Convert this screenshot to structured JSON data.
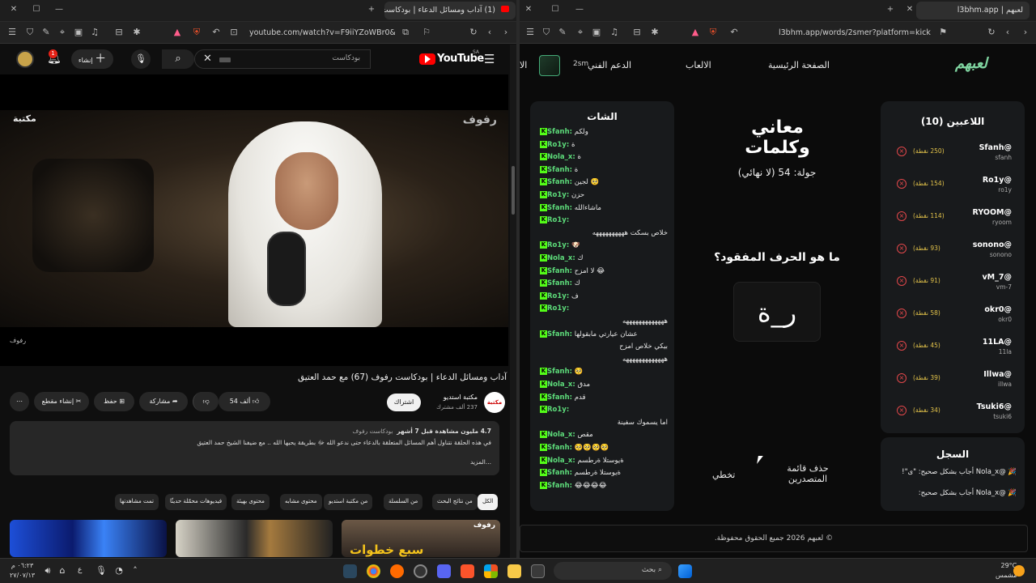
{
  "left_window": {
    "tab_title": "(1) آداب ومسائل الدعاء | بودكاست",
    "url": "youtube.com/watch?v=F9iiYZoWBr0&t=4s",
    "youtube": {
      "logo": "YouTube",
      "region": "SA",
      "search_value": "بودكاست",
      "create_label": "إنشاء",
      "notification_count": "1",
      "video_title": "آداب ومسائل الدعاء | بودكاست رفوف (67) مع حمد العتيق",
      "watermark": "رفوف",
      "channel_name": "مكتبة استديو",
      "channel_logo": "مكتبة",
      "subscribers": "237 ألف مشترك",
      "subscribe_label": "اشتراك",
      "likes": "54 ألف",
      "share_label": "مشاركة",
      "save_label": "حفظ",
      "clip_label": "إنشاء مقطع",
      "description_meta": "4.7 مليون مشاهدة قبل 7 أشهر",
      "description_tag": "بودكاست رفوف",
      "description_text": "في هذه الحلقة نتناول أهم المسائل المتعلقة بالدعاء حتى ندعو الله ﷻ بطريقة يحبها الله .. مع ضيفنا الشيخ حمد العتيق",
      "more_label": "...المزيد",
      "chips": [
        "الكل",
        "من نتائج البحث",
        "من السلسلة",
        "من مكتبة استديو",
        "محتوى مشابه",
        "محتوى بهيئة",
        "فيديوهات محمّلة حديثًا",
        "تمت مشاهدتها"
      ],
      "thumb_text": "سبع خطوات"
    }
  },
  "right_window": {
    "tab_title": "لعبهم | l3bhm.app",
    "url": "l3bhm.app/words/2smer?platform=kick",
    "site": {
      "logo": "لعبهم",
      "nav": [
        "الصفحة الرئيسية",
        "الالعاب",
        "الدعم الفني"
      ],
      "nav_cut": "الا",
      "user_handle": "2sm",
      "game_title": "معاني وكلمات",
      "round_label": "جولة: 54 (لا نهائي)",
      "question": "ما هو الحرف المفقود؟",
      "letters": "ر_ة",
      "skip_label": "تخطي",
      "delete_leaderboard_label": "حذف قائمة المتصدرين",
      "footer": "© لعبهم 2026 جميع الحقوق محفوظة."
    },
    "players_title": "اللاعبين (10)",
    "players": [
      {
        "name": "@Sfanh",
        "handle": "sfanh",
        "points": "(250 نقطة)"
      },
      {
        "name": "@Ro1y",
        "handle": "ro1y",
        "points": "(154 نقطة)"
      },
      {
        "name": "@RYOOM",
        "handle": "ryoom",
        "points": "(114 نقطة)"
      },
      {
        "name": "@sonono",
        "handle": "sonono",
        "points": "(93 نقطة)"
      },
      {
        "name": "@vM_7",
        "handle": "vm-7",
        "points": "(91 نقطة)"
      },
      {
        "name": "@okr0",
        "handle": "okr0",
        "points": "(58 نقطة)"
      },
      {
        "name": "@11LA",
        "handle": "11la",
        "points": "(45 نقطة)"
      },
      {
        "name": "@Illwa",
        "handle": "illwa",
        "points": "(39 نقطة)"
      },
      {
        "name": "@Tsuki6",
        "handle": "tsuki6",
        "points": "(34 نقطة)"
      }
    ],
    "log_title": "السجل",
    "log": [
      "🎉 @Nola_x أجاب بشكل صحيح: \"ى\"!",
      "🎉 @Nola_x أجاب بشكل صحيح:"
    ],
    "chat_title": "الشات",
    "chat": [
      {
        "user": "Sfanh",
        "msg": "ولكم"
      },
      {
        "user": "Ro1y",
        "msg": "ة"
      },
      {
        "user": "Nola_x",
        "msg": "ة"
      },
      {
        "user": "Sfanh",
        "msg": "ة"
      },
      {
        "user": "Sfanh",
        "msg": "لجين 🥺"
      },
      {
        "user": "Ro1y",
        "msg": "حزن"
      },
      {
        "user": "Sfanh",
        "msg": "ماشاءالله"
      },
      {
        "user": "Ro1y",
        "msg": ""
      },
      {
        "user": "",
        "msg": "خلاص بسكت ههههههههههه"
      },
      {
        "user": "Ro1y",
        "msg": "🐶"
      },
      {
        "user": "Nola_x",
        "msg": "ك"
      },
      {
        "user": "Sfanh",
        "msg": "لا امزح 😂"
      },
      {
        "user": "Sfanh",
        "msg": "ك"
      },
      {
        "user": "Ro1y",
        "msg": "ف"
      },
      {
        "user": "Ro1y",
        "msg": ""
      },
      {
        "user": "",
        "msg": "هههههههههههههه"
      },
      {
        "user": "Sfanh",
        "msg": "عشان عيارتي مابقولها"
      },
      {
        "user": "",
        "msg": "بيكي خلاص امزح"
      },
      {
        "user": "",
        "msg": "هههههههههههههه"
      },
      {
        "user": "Sfanh",
        "msg": "🥺"
      },
      {
        "user": "Nola_x",
        "msg": "مدق"
      },
      {
        "user": "Sfanh",
        "msg": "قدم"
      },
      {
        "user": "Ro1y",
        "msg": ""
      },
      {
        "user": "",
        "msg": "اما يسموك سفينة"
      },
      {
        "user": "Nola_x",
        "msg": "مقص"
      },
      {
        "user": "Sfanh",
        "msg": "🥺🥺🥺🥺"
      },
      {
        "user": "Nola_x",
        "msg": "ةيوستلا ةرطسم"
      },
      {
        "user": "Sfanh",
        "msg": "ةيوستلا ةرطسم"
      },
      {
        "user": "Sfanh",
        "msg": "😂😂😂😂"
      }
    ]
  },
  "taskbar": {
    "search_placeholder": "بحث",
    "temperature": "29°C",
    "weather": "مشمس",
    "time": "٠٦:٢٣ م",
    "date": "٢٧/٠٧/١٣",
    "lang": "ع"
  },
  "colors": {
    "accent_green": "#53fc18",
    "points_gold": "#e3c34a",
    "remove_red": "#e2474a",
    "yt_red": "#ff0000"
  }
}
